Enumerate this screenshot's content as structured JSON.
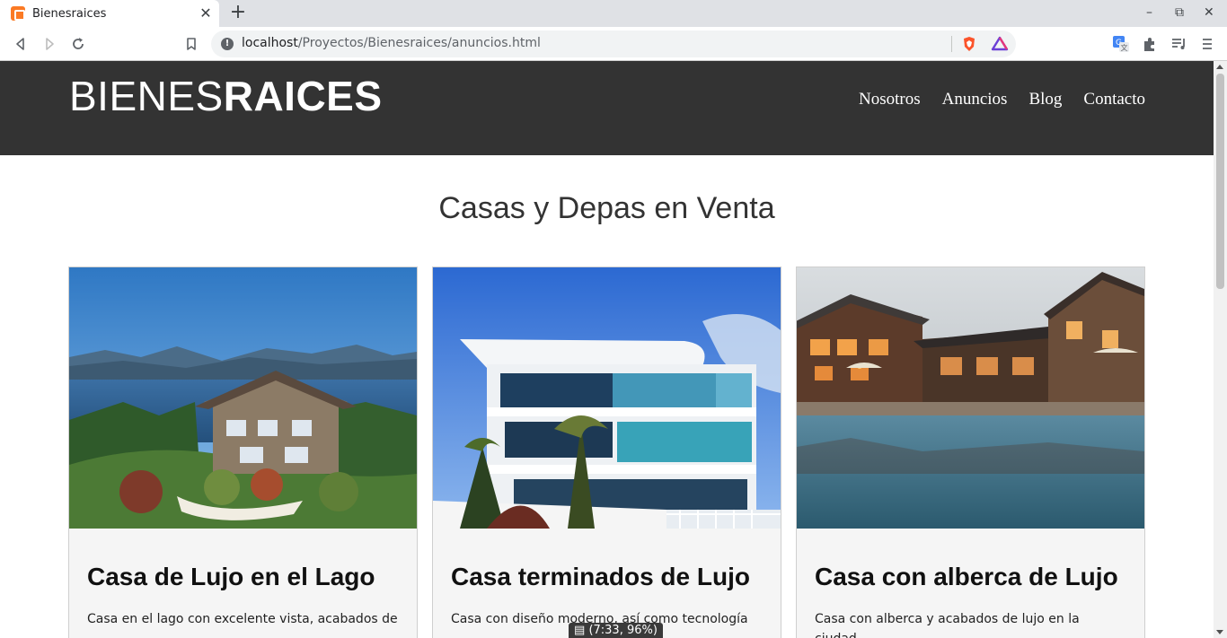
{
  "browser": {
    "tab_title": "Bienesraices",
    "url_host": "localhost",
    "url_path": "/Proyectos/Bienesraices/anuncios.html"
  },
  "header": {
    "logo_light": "BIENES",
    "logo_bold": "RAICES",
    "nav": [
      "Nosotros",
      "Anuncios",
      "Blog",
      "Contacto"
    ]
  },
  "main": {
    "title": "Casas y Depas en Venta",
    "cards": [
      {
        "title": "Casa de Lujo en el Lago",
        "text": "Casa en el lago con excelente vista, acabados de"
      },
      {
        "title": "Casa terminados de Lujo",
        "text": "Casa con diseño moderno, así como tecnología"
      },
      {
        "title": "Casa con alberca de Lujo",
        "text": "Casa con alberca y acabados de lujo en la ciudad,"
      }
    ]
  },
  "status": {
    "text": "(7:33, 96%)"
  },
  "colors": {
    "header_bg": "#333333",
    "card_bg": "#f5f5f5",
    "brand_icon": "#fb7a24"
  }
}
